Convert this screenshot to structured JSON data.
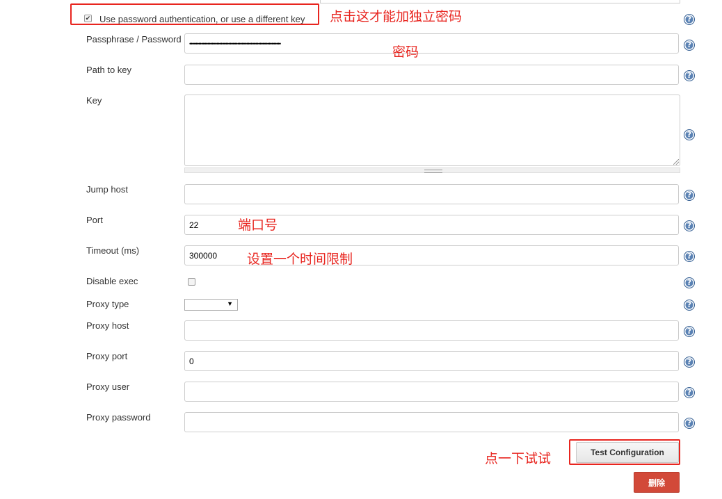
{
  "auth": {
    "checkbox_label": "Use password authentication, or use a different key",
    "checked": true
  },
  "fields": {
    "passphrase": {
      "label": "Passphrase / Password",
      "value": "•••••••••••••••••••••••••••••••••••••••••••••••••••••••••••••"
    },
    "path_to_key": {
      "label": "Path to key",
      "value": ""
    },
    "key": {
      "label": "Key",
      "value": ""
    },
    "jump_host": {
      "label": "Jump host",
      "value": ""
    },
    "port": {
      "label": "Port",
      "value": "22"
    },
    "timeout": {
      "label": "Timeout (ms)",
      "value": "300000"
    },
    "disable_exec": {
      "label": "Disable exec",
      "checked": false
    },
    "proxy_type": {
      "label": "Proxy type",
      "value": ""
    },
    "proxy_host": {
      "label": "Proxy host",
      "value": ""
    },
    "proxy_port": {
      "label": "Proxy port",
      "value": "0"
    },
    "proxy_user": {
      "label": "Proxy user",
      "value": ""
    },
    "proxy_password": {
      "label": "Proxy password",
      "value": ""
    }
  },
  "buttons": {
    "test_configuration": "Test Configuration",
    "delete": "删除"
  },
  "help_glyph": "?",
  "annotations": {
    "checkbox_note": "点击这才能加独立密码",
    "password_note": "密码",
    "port_note": "端口号",
    "timeout_note": "设置一个时间限制",
    "test_note": "点一下试试"
  },
  "colors": {
    "annotation_red": "#e8251f",
    "help_blue": "#5a82b4",
    "delete_button": "#d24939"
  }
}
